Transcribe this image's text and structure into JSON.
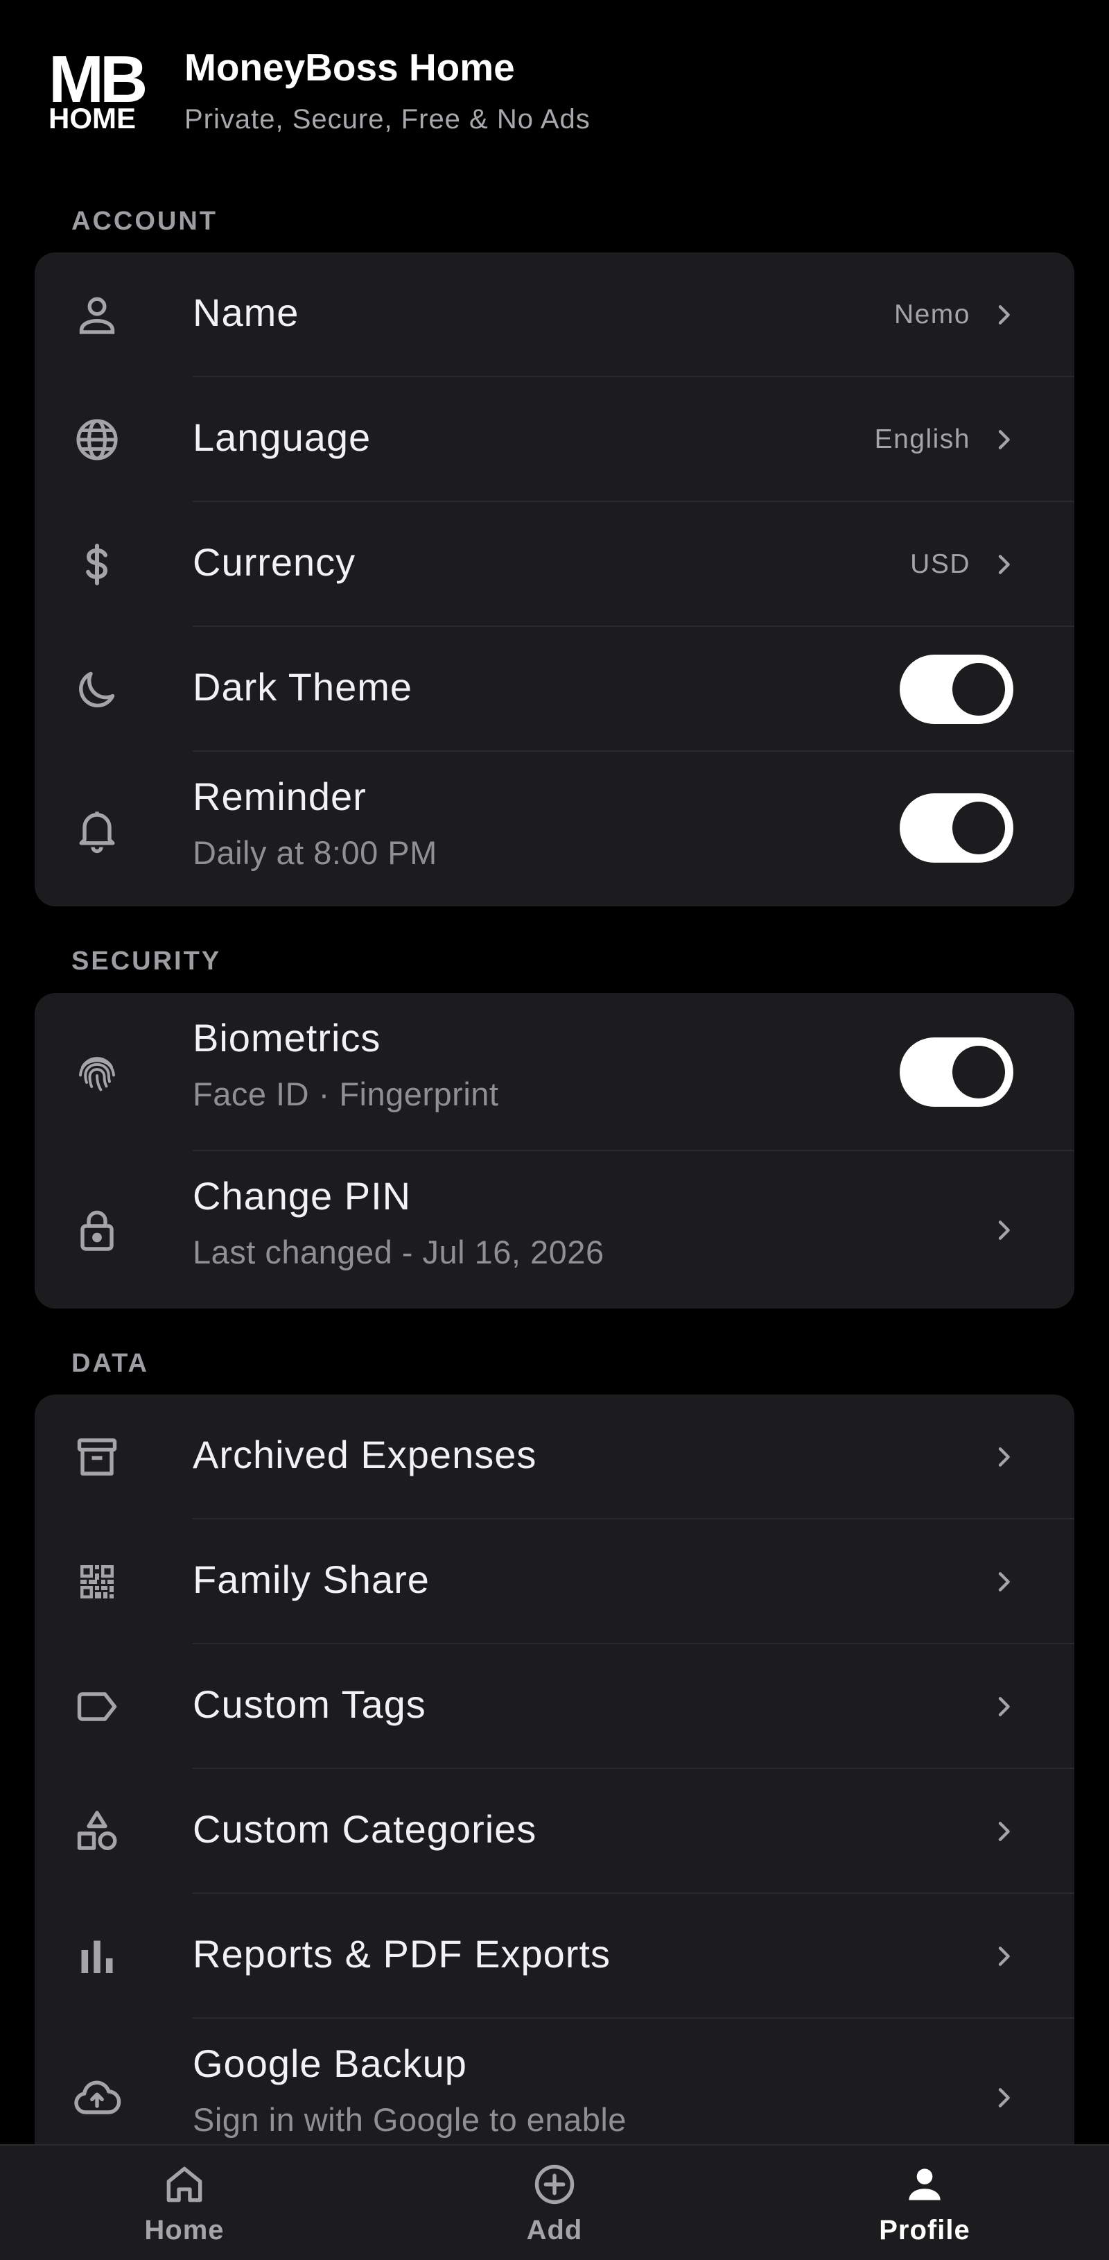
{
  "app": {
    "logo_top": "MB",
    "logo_bottom": "HOME",
    "title": "MoneyBoss Home",
    "subtitle": "Private, Secure, Free & No Ads"
  },
  "sections": {
    "account": "ACCOUNT",
    "security": "SECURITY",
    "data": "DATA"
  },
  "account": {
    "name": {
      "label": "Name",
      "value": "Nemo",
      "icon": "person-icon"
    },
    "language": {
      "label": "Language",
      "value": "English",
      "icon": "globe-icon"
    },
    "currency": {
      "label": "Currency",
      "value": "USD",
      "icon": "dollar-icon"
    },
    "dark_theme": {
      "label": "Dark Theme",
      "enabled": true,
      "icon": "moon-icon"
    },
    "reminder": {
      "label": "Reminder",
      "sub": "Daily at 8:00 PM",
      "enabled": true,
      "icon": "bell-icon"
    }
  },
  "security": {
    "biometrics": {
      "label": "Biometrics",
      "sub": "Face ID · Fingerprint",
      "enabled": true,
      "icon": "fingerprint-icon"
    },
    "change_pin": {
      "label": "Change PIN",
      "sub": "Last changed - Jul 16, 2026",
      "icon": "lock-icon"
    }
  },
  "data": {
    "archived": {
      "label": "Archived Expenses",
      "icon": "archive-icon"
    },
    "family": {
      "label": "Family Share",
      "icon": "qr-code-icon"
    },
    "tags": {
      "label": "Custom Tags",
      "icon": "tag-icon"
    },
    "categories": {
      "label": "Custom Categories",
      "icon": "shapes-icon"
    },
    "reports": {
      "label": "Reports & PDF Exports",
      "icon": "bar-chart-icon"
    },
    "backup": {
      "label": "Google Backup",
      "sub": "Sign in with Google to enable",
      "icon": "cloud-upload-icon"
    }
  },
  "nav": {
    "home": {
      "label": "Home",
      "icon": "home-icon"
    },
    "add": {
      "label": "Add",
      "icon": "add-circle-icon"
    },
    "profile": {
      "label": "Profile",
      "icon": "profile-icon",
      "active": true
    }
  },
  "colors": {
    "background": "#000000",
    "card": "#1c1c1e",
    "text_primary": "#f2f2f4",
    "text_secondary": "#8f8f94",
    "toggle_on": "#ffffff"
  }
}
